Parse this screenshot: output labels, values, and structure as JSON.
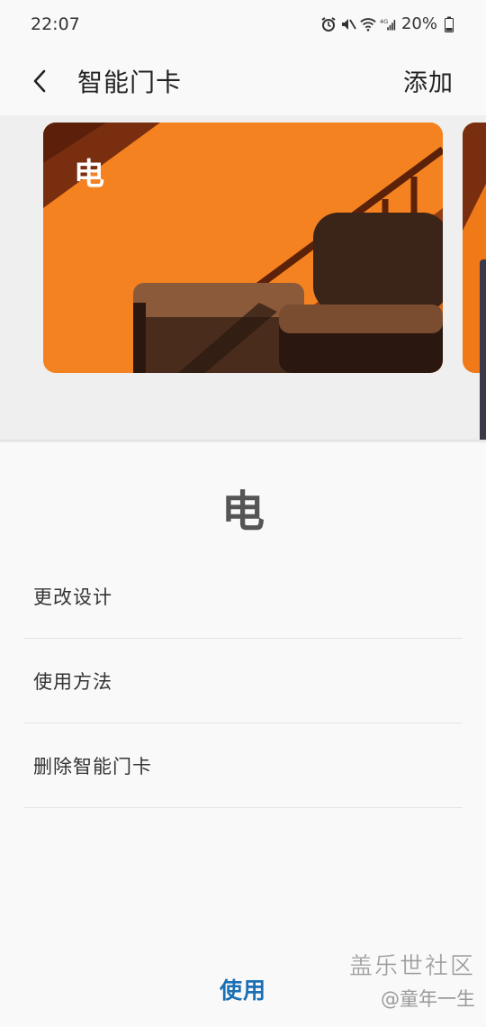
{
  "status_bar": {
    "time": "22:07",
    "battery": "20%",
    "icons": [
      "alarm-icon",
      "mute-icon",
      "wifi-icon",
      "signal-4g-icon",
      "battery-icon"
    ]
  },
  "app_bar": {
    "title": "智能门卡",
    "add_label": "添加"
  },
  "card": {
    "label": "电",
    "colors": {
      "primary": "#f58220",
      "shadow": "#7a2e10",
      "sofa": "#3b2418"
    }
  },
  "detail": {
    "name": "电",
    "menu": [
      {
        "label": "更改设计"
      },
      {
        "label": "使用方法"
      },
      {
        "label": "删除智能门卡"
      }
    ]
  },
  "bottom": {
    "use_label": "使用",
    "accent": "#1a6fb5"
  },
  "watermark": {
    "title": "盖乐世社区",
    "author": "@童年一生"
  }
}
